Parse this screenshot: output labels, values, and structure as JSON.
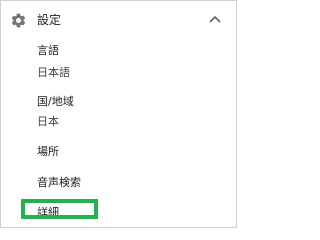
{
  "header": {
    "title": "設定",
    "icon": "gear-icon",
    "toggle_icon": "chevron-up-icon",
    "expanded": true
  },
  "items": [
    {
      "label": "言語",
      "value": "日本語"
    },
    {
      "label": "国/地域",
      "value": "日本"
    },
    {
      "label": "場所"
    },
    {
      "label": "音声検索"
    },
    {
      "label": "詳細"
    }
  ],
  "highlight": {
    "target": "詳細",
    "color": "#22b14c"
  }
}
